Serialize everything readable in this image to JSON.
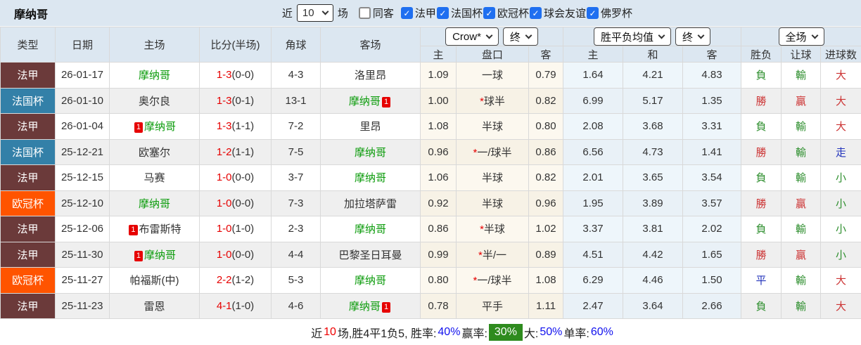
{
  "topbar": {
    "title": "摩纳哥",
    "near_label": "近",
    "match_count": "10",
    "games_label": "场",
    "checkboxes": [
      {
        "label": "同客",
        "checked": false
      },
      {
        "label": "法甲",
        "checked": true
      },
      {
        "label": "法国杯",
        "checked": true
      },
      {
        "label": "欧冠杯",
        "checked": true
      },
      {
        "label": "球会友谊",
        "checked": true
      },
      {
        "label": "佛罗杯",
        "checked": true
      }
    ]
  },
  "controls": {
    "odds_source": "Crow*",
    "asia_time": "终",
    "euro_source": "胜平负均值",
    "euro_time": "终",
    "scope": "全场"
  },
  "columns": {
    "type": "类型",
    "date": "日期",
    "home": "主场",
    "score": "比分(半场)",
    "corners": "角球",
    "away": "客场",
    "asia_home": "主",
    "asia_handicap": "盘口",
    "asia_away": "客",
    "euro_home": "主",
    "euro_draw": "和",
    "euro_away": "客",
    "result_wdl": "胜负",
    "result_handicap": "让球",
    "result_goals": "进球数"
  },
  "colors": {
    "league_ligue1": "#6b3a3a",
    "league_french_cup": "#3380a8",
    "league_ucl": "#ff5400",
    "win_red": "#cc3333",
    "loss_green": "#2f8f2f",
    "draw_blue": "#2233bb",
    "monaco_green": "#0a9b0a",
    "score_red": "#e60000",
    "checkbox_blue": "#1f6ff0",
    "win_pct_chip_green": "#2e8b1e"
  },
  "rows": [
    {
      "league": "法甲",
      "date": "26-01-17",
      "home_badge": "",
      "home": "摩纳哥",
      "score": "1-3",
      "half": "(0-0)",
      "corners": "4-3",
      "away": "洛里昂",
      "away_badge": "",
      "asia_home": "1.09",
      "star": "",
      "handicap": "一球",
      "asia_away": "0.79",
      "euro_home": "1.64",
      "euro_draw": "4.21",
      "euro_away": "4.83",
      "result_wdl": "負",
      "result_handicap": "輸",
      "result_goals": "大"
    },
    {
      "league": "法国杯",
      "date": "26-01-10",
      "home_badge": "",
      "home": "奥尔良",
      "score": "1-3",
      "half": "(0-1)",
      "corners": "13-1",
      "away": "摩纳哥",
      "away_badge": "1",
      "asia_home": "1.00",
      "star": "*",
      "handicap": "球半",
      "asia_away": "0.82",
      "euro_home": "6.99",
      "euro_draw": "5.17",
      "euro_away": "1.35",
      "result_wdl": "勝",
      "result_handicap": "贏",
      "result_goals": "大"
    },
    {
      "league": "法甲",
      "date": "26-01-04",
      "home_badge": "1",
      "home": "摩纳哥",
      "score": "1-3",
      "half": "(1-1)",
      "corners": "7-2",
      "away": "里昂",
      "away_badge": "",
      "asia_home": "1.08",
      "star": "",
      "handicap": "半球",
      "asia_away": "0.80",
      "euro_home": "2.08",
      "euro_draw": "3.68",
      "euro_away": "3.31",
      "result_wdl": "負",
      "result_handicap": "輸",
      "result_goals": "大"
    },
    {
      "league": "法国杯",
      "date": "25-12-21",
      "home_badge": "",
      "home": "欧塞尔",
      "score": "1-2",
      "half": "(1-1)",
      "corners": "7-5",
      "away": "摩纳哥",
      "away_badge": "",
      "asia_home": "0.96",
      "star": "*",
      "handicap": "一/球半",
      "asia_away": "0.86",
      "euro_home": "6.56",
      "euro_draw": "4.73",
      "euro_away": "1.41",
      "result_wdl": "勝",
      "result_handicap": "輸",
      "result_goals": "走"
    },
    {
      "league": "法甲",
      "date": "25-12-15",
      "home_badge": "",
      "home": "马赛",
      "score": "1-0",
      "half": "(0-0)",
      "corners": "3-7",
      "away": "摩纳哥",
      "away_badge": "",
      "asia_home": "1.06",
      "star": "",
      "handicap": "半球",
      "asia_away": "0.82",
      "euro_home": "2.01",
      "euro_draw": "3.65",
      "euro_away": "3.54",
      "result_wdl": "負",
      "result_handicap": "輸",
      "result_goals": "小"
    },
    {
      "league": "欧冠杯",
      "date": "25-12-10",
      "home_badge": "",
      "home": "摩纳哥",
      "score": "1-0",
      "half": "(0-0)",
      "corners": "7-3",
      "away": "加拉塔萨雷",
      "away_badge": "",
      "asia_home": "0.92",
      "star": "",
      "handicap": "半球",
      "asia_away": "0.96",
      "euro_home": "1.95",
      "euro_draw": "3.89",
      "euro_away": "3.57",
      "result_wdl": "勝",
      "result_handicap": "贏",
      "result_goals": "小"
    },
    {
      "league": "法甲",
      "date": "25-12-06",
      "home_badge": "1",
      "home": "布雷斯特",
      "score": "1-0",
      "half": "(1-0)",
      "corners": "2-3",
      "away": "摩纳哥",
      "away_badge": "",
      "asia_home": "0.86",
      "star": "*",
      "handicap": "半球",
      "asia_away": "1.02",
      "euro_home": "3.37",
      "euro_draw": "3.81",
      "euro_away": "2.02",
      "result_wdl": "負",
      "result_handicap": "輸",
      "result_goals": "小"
    },
    {
      "league": "法甲",
      "date": "25-11-30",
      "home_badge": "1",
      "home": "摩纳哥",
      "score": "1-0",
      "half": "(0-0)",
      "corners": "4-4",
      "away": "巴黎圣日耳曼",
      "away_badge": "",
      "asia_home": "0.99",
      "star": "*",
      "handicap": "半/一",
      "asia_away": "0.89",
      "euro_home": "4.51",
      "euro_draw": "4.42",
      "euro_away": "1.65",
      "result_wdl": "勝",
      "result_handicap": "贏",
      "result_goals": "小"
    },
    {
      "league": "欧冠杯",
      "date": "25-11-27",
      "home_badge": "",
      "home": "帕福斯(中)",
      "score": "2-2",
      "half": "(1-2)",
      "corners": "5-3",
      "away": "摩纳哥",
      "away_badge": "",
      "asia_home": "0.80",
      "star": "*",
      "handicap": "一/球半",
      "asia_away": "1.08",
      "euro_home": "6.29",
      "euro_draw": "4.46",
      "euro_away": "1.50",
      "result_wdl": "平",
      "result_handicap": "輸",
      "result_goals": "大"
    },
    {
      "league": "法甲",
      "date": "25-11-23",
      "home_badge": "",
      "home": "雷恩",
      "score": "4-1",
      "half": "(1-0)",
      "corners": "4-6",
      "away": "摩纳哥",
      "away_badge": "1",
      "asia_home": "0.78",
      "star": "",
      "handicap": "平手",
      "asia_away": "1.11",
      "euro_home": "2.47",
      "euro_draw": "3.64",
      "euro_away": "2.66",
      "result_wdl": "負",
      "result_handicap": "輸",
      "result_goals": "大"
    }
  ],
  "footer": {
    "prefix": "近",
    "count": "10",
    "mid": "场,胜4平1负5, 胜率:",
    "win_rate": "40%",
    "label_win": "赢率:",
    "win_pct": "30%",
    "label_big": "大:",
    "big_pct": "50%",
    "label_single": "单率:",
    "single_pct": "60%"
  }
}
